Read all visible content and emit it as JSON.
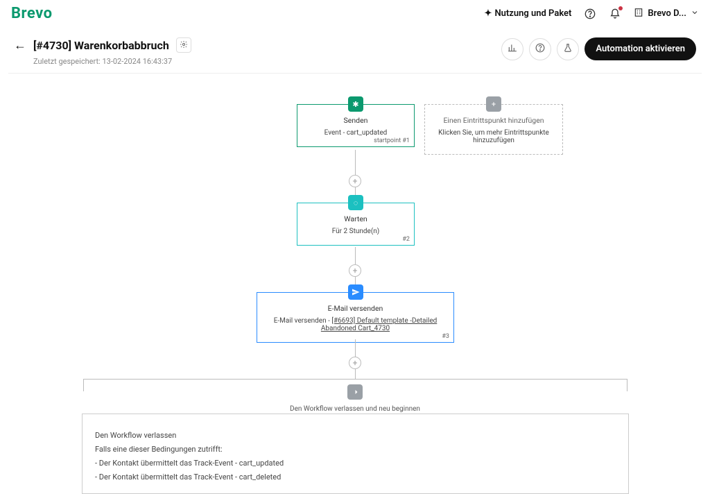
{
  "topbar": {
    "logo": "Brevo",
    "usage_link": "Nutzung und Paket",
    "org_name": "Brevo D..."
  },
  "header": {
    "title": "[#4730] Warenkorbabbruch",
    "saved_prefix": "Zuletzt gespeichert: ",
    "saved_time": "13-02-2024 16:43:37",
    "activate_label": "Automation aktivieren"
  },
  "nodes": {
    "entry": {
      "title": "Senden",
      "subtitle": "Event - cart_updated",
      "step": "startpoint #1"
    },
    "add_entry": {
      "title": "Einen Eintrittspunkt hinzufügen",
      "subtitle": "Klicken Sie, um mehr Eintrittspunkte hinzuzufügen"
    },
    "wait": {
      "title": "Warten",
      "subtitle": "Für 2 Stunde(n)",
      "step": "#2"
    },
    "email": {
      "title": "E-Mail versenden",
      "prefix": "E-Mail versenden - ",
      "template": "[#6693] Default template -Detailed Abandoned Cart_4730",
      "step": "#3"
    },
    "exit": {
      "header": "Den Workflow verlassen und neu beginnen",
      "line1": "Den Workflow verlassen",
      "line2": "Falls eine dieser Bedingungen zutrifft:",
      "line3": "- Der Kontakt übermittelt das Track-Event - cart_updated",
      "line4": "- Der Kontakt übermittelt das Track-Event - cart_deleted"
    }
  }
}
